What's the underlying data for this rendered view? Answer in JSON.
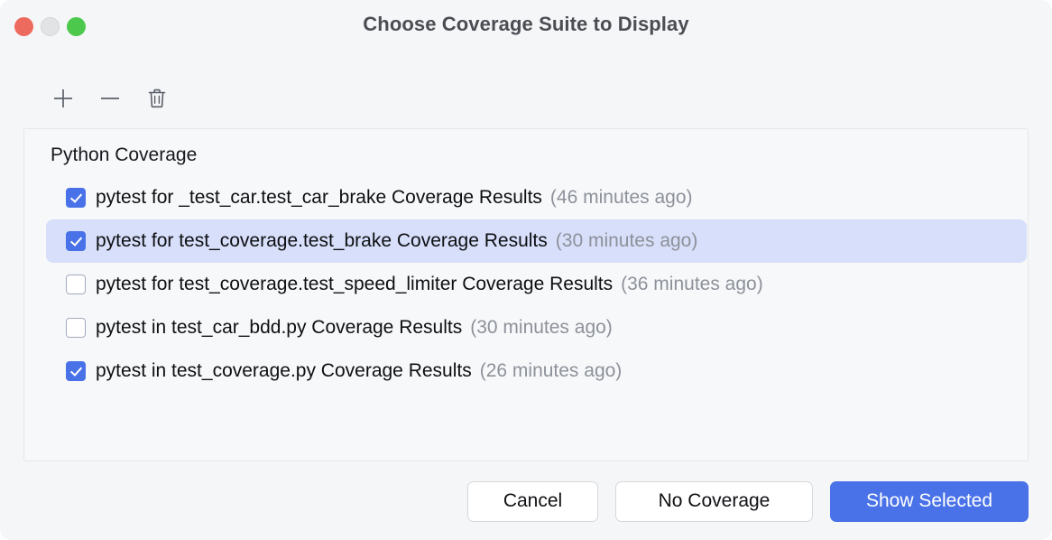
{
  "window": {
    "title": "Choose Coverage Suite to Display",
    "traffic_lights": {
      "close": "close-button",
      "minimize": "minimize-button",
      "maximize": "maximize-button"
    },
    "accent_color": "#4a72e8",
    "selection_color": "#d7dffa",
    "background_color": "#f5f6f8"
  },
  "toolbar": {
    "buttons": [
      {
        "name": "add-suite-button",
        "icon": "plus-icon",
        "label": "+"
      },
      {
        "name": "remove-suite-button",
        "icon": "minus-icon",
        "label": "−"
      },
      {
        "name": "delete-suite-button",
        "icon": "trash-icon",
        "label": "Delete"
      }
    ]
  },
  "list": {
    "group_label": "Python Coverage",
    "rows": [
      {
        "label": "pytest for _test_car.test_car_brake Coverage Results",
        "time": "(46 minutes ago)",
        "checked": true,
        "selected": false
      },
      {
        "label": "pytest for test_coverage.test_brake Coverage Results",
        "time": "(30 minutes ago)",
        "checked": true,
        "selected": true
      },
      {
        "label": "pytest for test_coverage.test_speed_limiter Coverage Results",
        "time": "(36 minutes ago)",
        "checked": false,
        "selected": false
      },
      {
        "label": "pytest in test_car_bdd.py Coverage Results",
        "time": "(30 minutes ago)",
        "checked": false,
        "selected": false
      },
      {
        "label": "pytest in test_coverage.py Coverage Results",
        "time": "(26 minutes ago)",
        "checked": true,
        "selected": false
      }
    ]
  },
  "footer": {
    "cancel_label": "Cancel",
    "no_coverage_label": "No Coverage",
    "show_selected_label": "Show Selected"
  }
}
